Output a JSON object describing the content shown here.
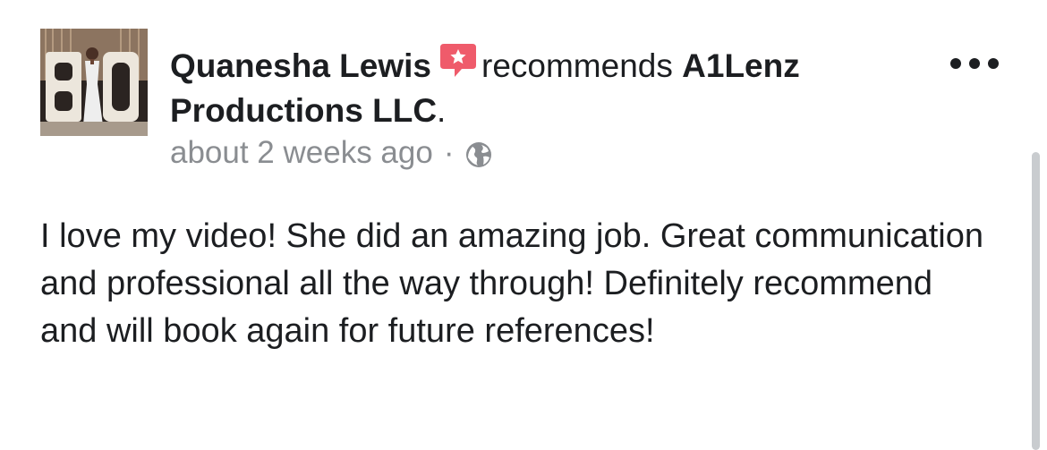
{
  "post": {
    "author": "Quanesha Lewis",
    "verb": "recommends",
    "page_name": "A1Lenz Productions LLC",
    "page_suffix": ".",
    "timestamp": "about 2 weeks ago",
    "separator": "·",
    "privacy_icon": "globe-icon",
    "badge_icon": "recommendation-star-icon",
    "more_icon": "more-options-icon",
    "text": "I love my video! She did an amazing job. Great communication and professional all the way through! Definitely recommend and will book again for future references!"
  },
  "colors": {
    "badge": "#ef5b6b",
    "meta_text": "#8a8d91",
    "primary_text": "#1c1e21"
  }
}
